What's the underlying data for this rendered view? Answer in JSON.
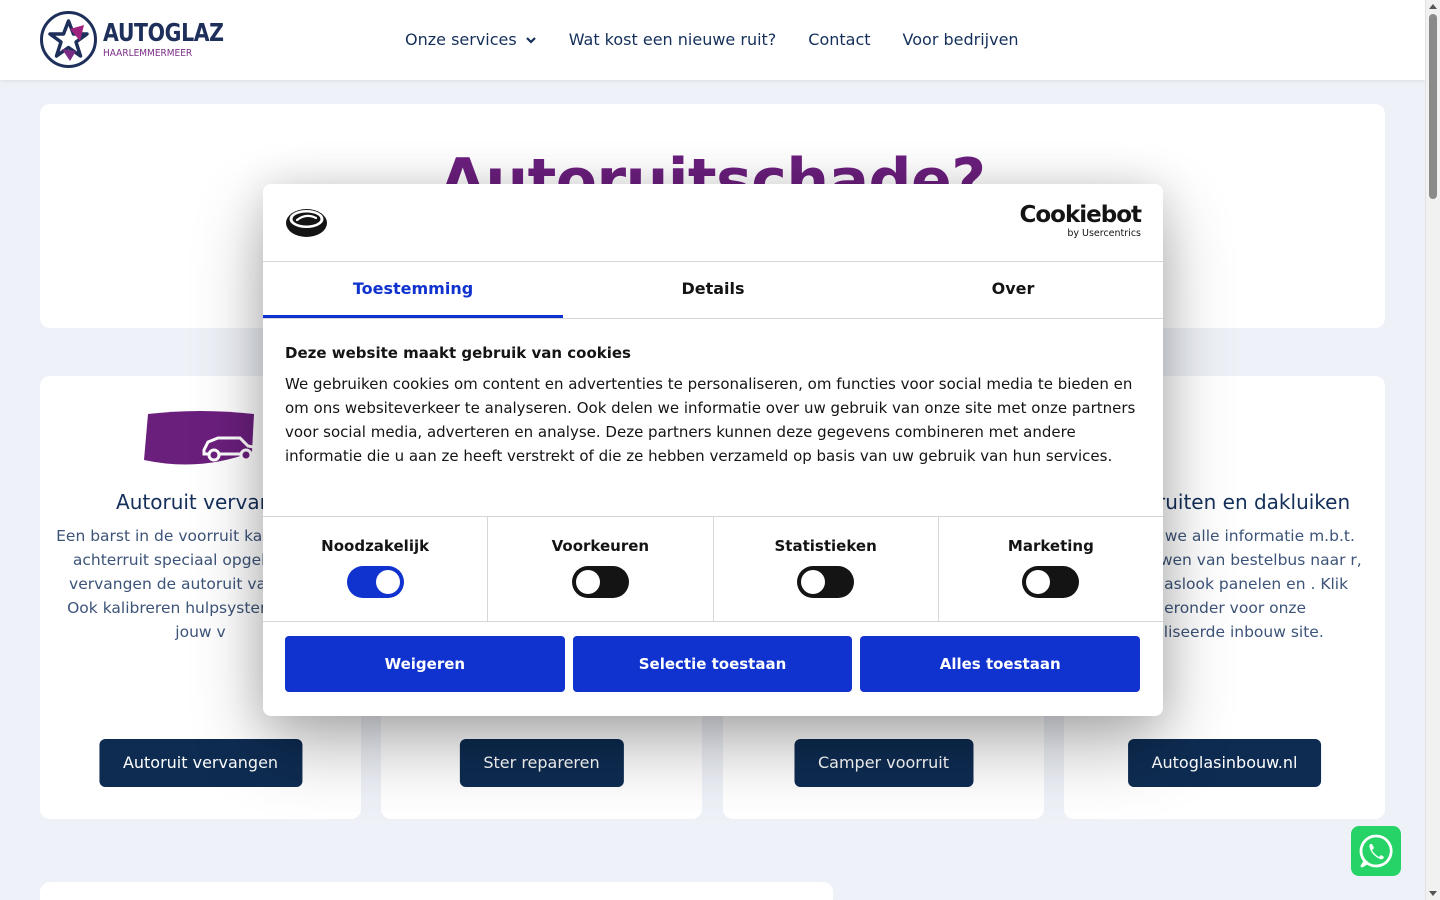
{
  "header": {
    "logo_name": "AUTOGLAZ",
    "logo_sub": "HAARLEMMERMEER",
    "nav": [
      {
        "label": "Onze services"
      },
      {
        "label": "Wat kost een nieuwe ruit?"
      },
      {
        "label": "Contact"
      },
      {
        "label": "Voor bedrijven"
      }
    ]
  },
  "hero": {
    "title": "Autoruitschade?"
  },
  "cards": [
    {
      "title": "Autoruit vervang",
      "text": "Een barst in de voorruit kapotte zij of achterruit speciaal opgeleide mo vervangen de autoruit va en snel. Ook kalibreren hulpsystemen voor jouw v",
      "button": "Autoruit vervangen"
    },
    {
      "button": "Ster repareren"
    },
    {
      "button": "Camper voorruit"
    },
    {
      "title": "ruiten en dakluiken",
      "text": "n we alle informatie m.b.t. uwen van bestelbus naar r, glaslook panelen en . Klik hieronder voor onze ialiseerde inbouw site.",
      "button": "Autoglasinbouw.nl"
    }
  ],
  "cookie": {
    "brand": "Cookiebot",
    "brand_sub": "by Usercentrics",
    "tabs": [
      "Toestemming",
      "Details",
      "Over"
    ],
    "heading": "Deze website maakt gebruik van cookies",
    "text": "We gebruiken cookies om content en advertenties te personaliseren, om functies voor social media te bieden en om ons websiteverkeer te analyseren. Ook delen we informatie over uw gebruik van onze site met onze partners voor social media, adverteren en analyse. Deze partners kunnen deze gegevens combineren met andere informatie die u aan ze heeft verstrekt of die ze hebben verzameld op basis van uw gebruik van hun services.",
    "toggles": [
      {
        "label": "Noodzakelijk",
        "on": true
      },
      {
        "label": "Voorkeuren",
        "on": false
      },
      {
        "label": "Statistieken",
        "on": false
      },
      {
        "label": "Marketing",
        "on": false
      }
    ],
    "buttons": [
      "Weigeren",
      "Selectie toestaan",
      "Alles toestaan"
    ]
  },
  "colors": {
    "accent": "#1032cf",
    "brand_purple": "#6b1f7d",
    "navy": "#0e2c52",
    "whatsapp": "#25d366"
  },
  "icons": [
    "logo-star-icon",
    "chevron-down-icon",
    "windshield-car-icon",
    "cookie-logo-icon",
    "whatsapp-icon"
  ]
}
